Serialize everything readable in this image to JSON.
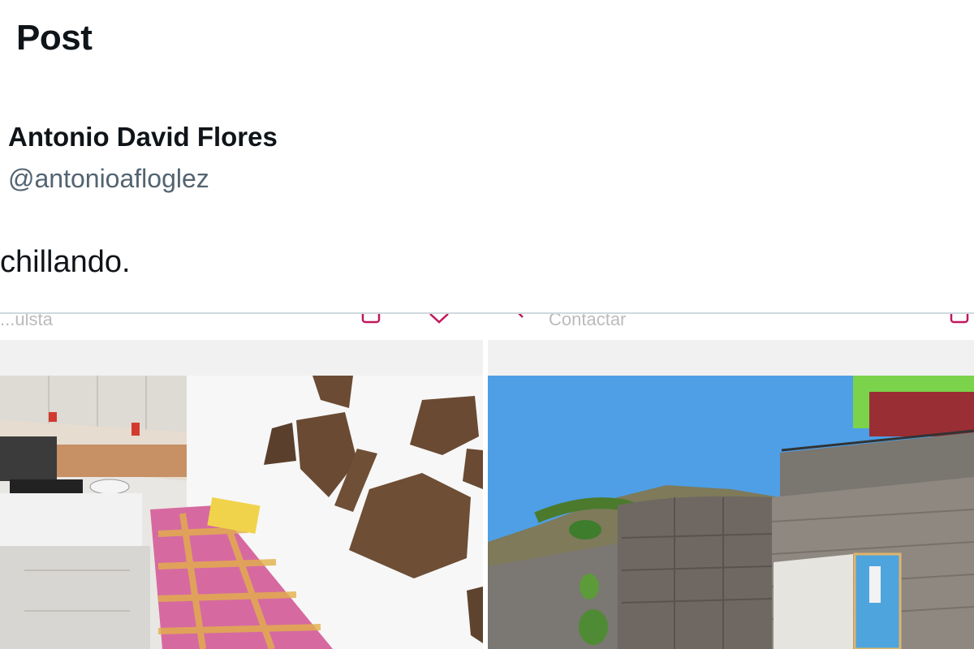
{
  "header": {
    "title": "Post"
  },
  "author": {
    "name": "Antonio David Flores",
    "handle": "@antonioafloglez"
  },
  "post": {
    "text": "chillando."
  },
  "embed": {
    "toolbar": {
      "left_text": "...ulsta",
      "right_text": "Contactar"
    },
    "images": [
      {
        "name": "interior-cave-room-photo"
      },
      {
        "name": "exterior-stone-house-photo"
      }
    ]
  }
}
